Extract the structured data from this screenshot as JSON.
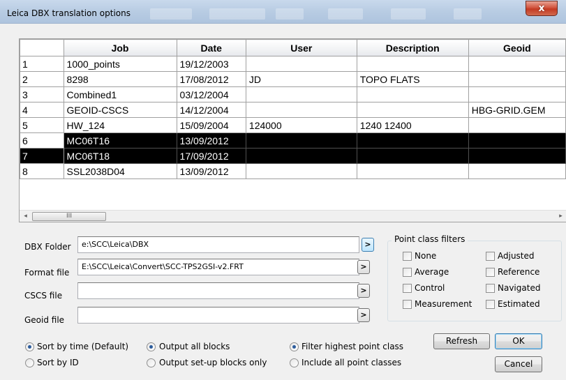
{
  "window": {
    "title": "Leica DBX translation options",
    "close_glyph": "x"
  },
  "grid": {
    "columns": [
      "Job",
      "Date",
      "User",
      "Description",
      "Geoid"
    ],
    "rows": [
      {
        "num": "1",
        "job": "1000_points",
        "date": "19/12/2003",
        "user": "",
        "description": "",
        "geoid": ""
      },
      {
        "num": "2",
        "job": "8298",
        "date": "17/08/2012",
        "user": "JD",
        "description": "TOPO FLATS",
        "geoid": ""
      },
      {
        "num": "3",
        "job": "Combined1",
        "date": "03/12/2004",
        "user": "",
        "description": "",
        "geoid": ""
      },
      {
        "num": "4",
        "job": "GEOID-CSCS",
        "date": "14/12/2004",
        "user": "",
        "description": "",
        "geoid": "HBG-GRID.GEM"
      },
      {
        "num": "5",
        "job": "HW_124",
        "date": "15/09/2004",
        "user": "124000",
        "description": "1240 12400",
        "geoid": ""
      },
      {
        "num": "6",
        "job": "MC06T16",
        "date": "13/09/2012",
        "user": "",
        "description": "",
        "geoid": ""
      },
      {
        "num": "7",
        "job": "MC06T18",
        "date": "17/09/2012",
        "user": "",
        "description": "",
        "geoid": ""
      },
      {
        "num": "8",
        "job": "SSL2038D04",
        "date": "13/09/2012",
        "user": "",
        "description": "",
        "geoid": ""
      }
    ],
    "scroll_left_glyph": "◂",
    "scroll_right_glyph": "▸",
    "thumb_grip": "III"
  },
  "fields": {
    "dbx_folder": {
      "label": "DBX Folder",
      "value": "e:\\SCC\\Leica\\DBX"
    },
    "format_file": {
      "label": "Format file",
      "value": "E:\\SCC\\Leica\\Convert\\SCC-TPS2GSI-v2.FRT"
    },
    "cscs_file": {
      "label": "CSCS file",
      "value": ""
    },
    "geoid_file": {
      "label": "Geoid file",
      "value": ""
    },
    "browse_label": ">"
  },
  "filters": {
    "title": "Point class filters",
    "left": [
      "None",
      "Average",
      "Control",
      "Measurement"
    ],
    "right": [
      "Adjusted",
      "Reference",
      "Navigated",
      "Estimated"
    ]
  },
  "sort": {
    "by_time": "Sort by time (Default)",
    "by_id": "Sort by ID",
    "selected": "by_time"
  },
  "output": {
    "all_blocks": "Output all blocks",
    "setup_only": "Output set-up blocks only",
    "selected": "all_blocks"
  },
  "class_filter": {
    "highest": "Filter highest point class",
    "all": "Include all point classes",
    "selected": "highest"
  },
  "buttons": {
    "refresh": "Refresh",
    "ok": "OK",
    "cancel": "Cancel"
  }
}
